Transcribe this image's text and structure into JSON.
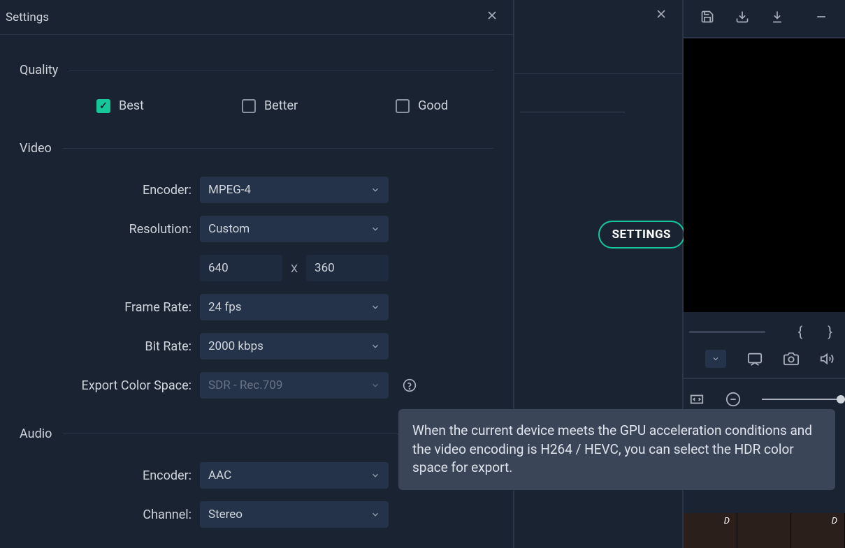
{
  "panel_title": "Settings",
  "quality": {
    "section_label": "Quality",
    "options": {
      "best": "Best",
      "better": "Better",
      "good": "Good"
    }
  },
  "video": {
    "section_label": "Video",
    "encoder_label": "Encoder:",
    "encoder_value": "MPEG-4",
    "resolution_label": "Resolution:",
    "resolution_value": "Custom",
    "width": "640",
    "height": "360",
    "res_sep": "X",
    "frame_rate_label": "Frame Rate:",
    "frame_rate_value": "24 fps",
    "bit_rate_label": "Bit Rate:",
    "bit_rate_value": "2000 kbps",
    "color_space_label": "Export Color Space:",
    "color_space_value": "SDR - Rec.709"
  },
  "audio": {
    "section_label": "Audio",
    "encoder_label": "Encoder:",
    "encoder_value": "AAC",
    "channel_label": "Channel:",
    "channel_value": "Stereo"
  },
  "settings_button": "SETTINGS",
  "tooltip_text": "When the current device meets the GPU acceleration conditions and the video encoding is H264 / HEVC, you can select the HDR color space for export.",
  "thumb_d": "D",
  "braces": {
    "open": "{",
    "close": "}"
  }
}
